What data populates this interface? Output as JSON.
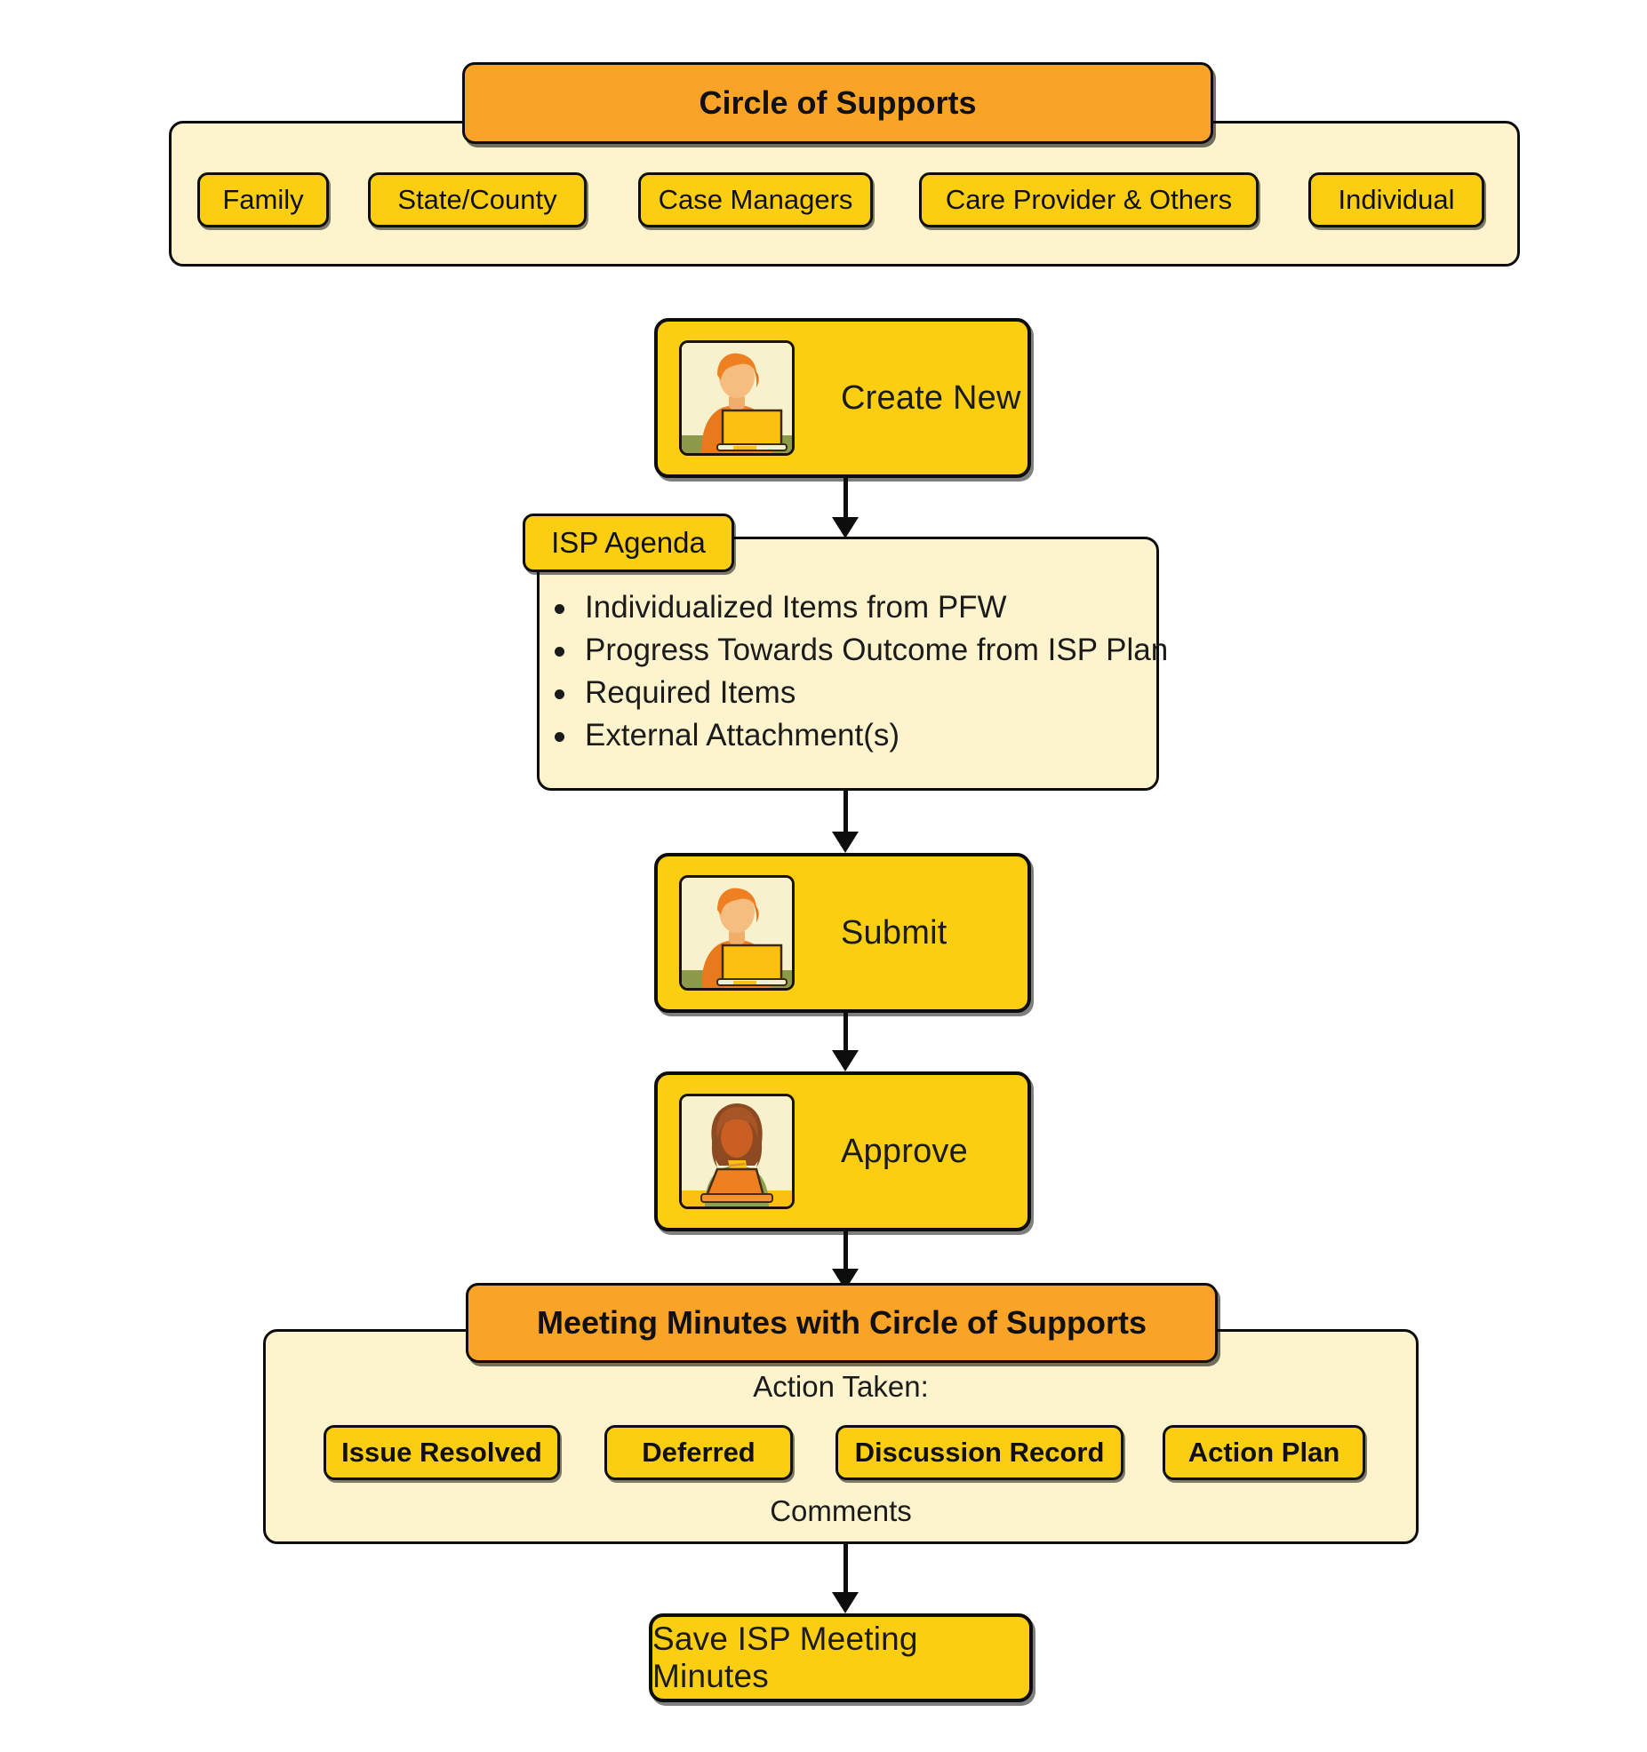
{
  "diagram": {
    "title": "ISP Meeting Minutes Workflow",
    "colors": {
      "header_orange": "#F9A427",
      "chip_yellow": "#FBCE12",
      "panel_cream": "#FDF4CE",
      "outline_black": "#0D0D0D"
    }
  },
  "circle_of_supports": {
    "header": "Circle of Supports",
    "members": [
      {
        "label": "Family"
      },
      {
        "label": "State/County"
      },
      {
        "label": "Case Managers"
      },
      {
        "label": "Care Provider & Others"
      },
      {
        "label": "Individual"
      }
    ]
  },
  "steps": {
    "create_new": {
      "label": "Create New",
      "icon": "person-at-laptop-icon"
    },
    "submit": {
      "label": "Submit",
      "icon": "person-at-laptop-icon"
    },
    "approve": {
      "label": "Approve",
      "icon": "woman-at-laptop-icon"
    },
    "save": {
      "label": "Save ISP Meeting Minutes"
    }
  },
  "isp_agenda": {
    "tab_label": "ISP Agenda",
    "items": [
      {
        "text": "Individualized Items from PFW"
      },
      {
        "text": "Progress Towards Outcome from ISP Plan"
      },
      {
        "text": "Required Items"
      },
      {
        "text": "External Attachment(s)"
      }
    ]
  },
  "meeting_minutes": {
    "header": "Meeting Minutes with Circle of Supports",
    "action_taken_label": "Action Taken:",
    "actions": [
      {
        "label": "Issue Resolved"
      },
      {
        "label": "Deferred"
      },
      {
        "label": "Discussion Record"
      },
      {
        "label": "Action Plan"
      }
    ],
    "comments_label": "Comments"
  }
}
